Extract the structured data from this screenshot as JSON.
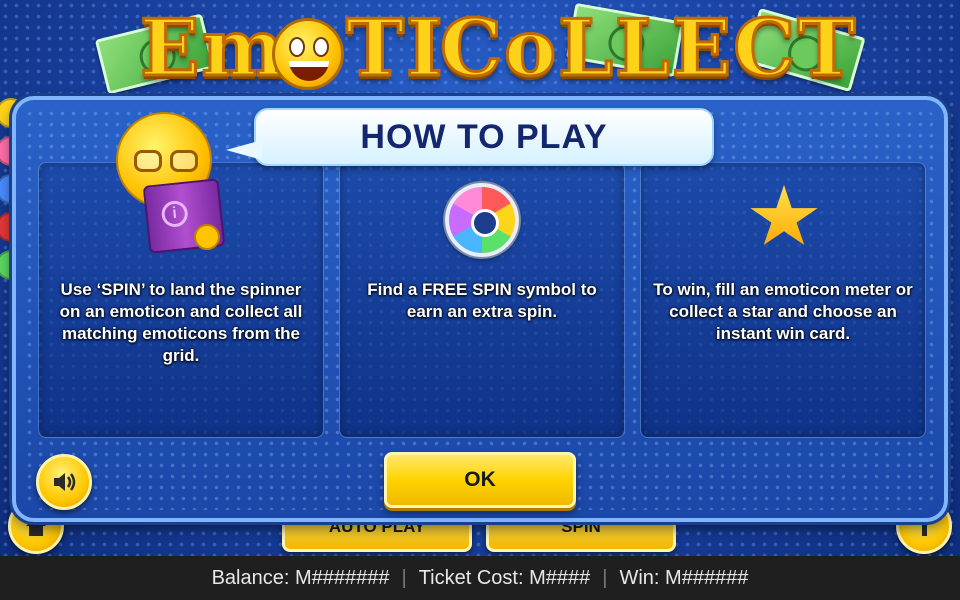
{
  "logo": {
    "word_left": "Em",
    "word_mid": "TI",
    "word_right": "CoLLECT"
  },
  "dialog": {
    "title": "HOW TO PLAY",
    "panels": [
      {
        "text": "Use ‘SPIN’ to land the spinner on an emoticon and collect all matching emoticons from the grid.",
        "icon": "reading-emoticon-icon"
      },
      {
        "text": "Find a FREE SPIN symbol to earn an extra spin.",
        "icon": "free-spin-wheel-icon"
      },
      {
        "text": "To win, fill an emoticon meter or collect a star and choose an instant win card.",
        "icon": "star-icon"
      }
    ],
    "ok_label": "OK",
    "sound_icon": "speaker-icon"
  },
  "controls": {
    "auto_play_label": "AUTO PLAY",
    "spin_label": "SPIN",
    "home_icon": "home-icon",
    "info_icon": "info-icon"
  },
  "status": {
    "balance_label": "Balance:",
    "balance_value": "M#######",
    "ticket_label": "Ticket Cost:",
    "ticket_value": "M####",
    "win_label": "Win:",
    "win_value": "M######",
    "separator": "|"
  },
  "colors": {
    "accent_yellow": "#ffd400",
    "title_text": "#13266e",
    "background_blue": "#1b45a6"
  }
}
